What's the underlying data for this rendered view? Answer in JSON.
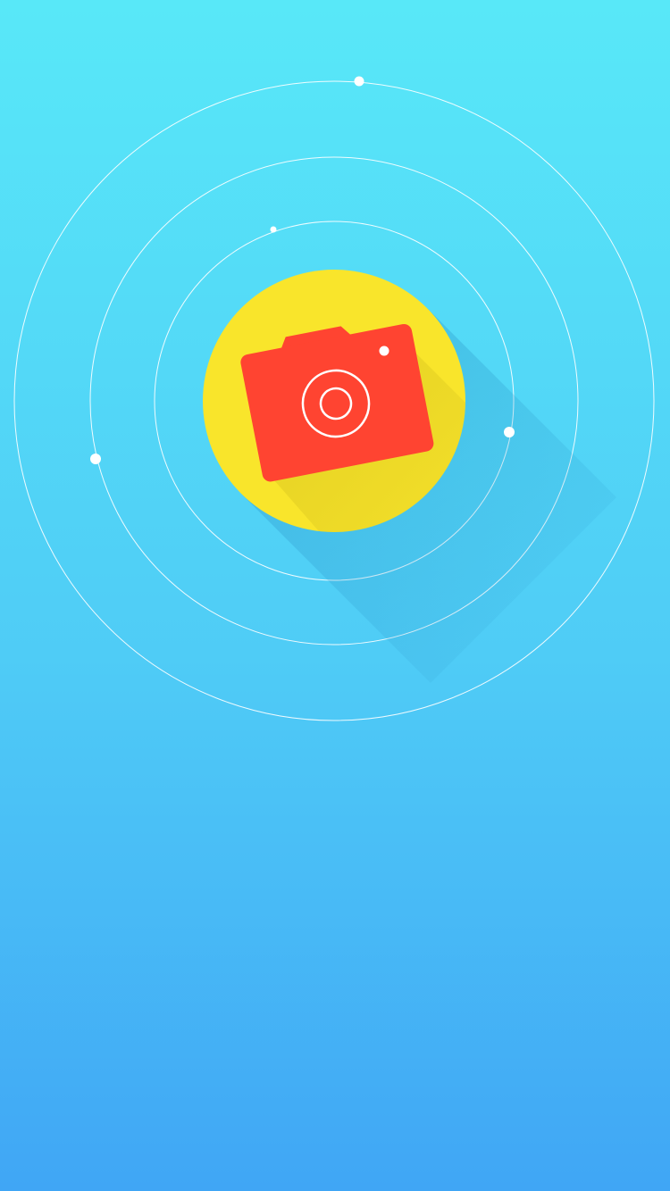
{
  "screen": {
    "name": "camera-splash",
    "background_top": "#58E8F8",
    "background_bottom": "#40A6F5"
  },
  "logo": {
    "icon": "camera-icon",
    "circle_color": "#F9E52B",
    "camera_color": "#FF4431",
    "lens_color": "#FFFFFF"
  },
  "orbits": {
    "count": 3,
    "ring_color": "#FFFFFF",
    "dot_color": "#FFFFFF",
    "dots_per_orbit": [
      1,
      2,
      2
    ]
  }
}
